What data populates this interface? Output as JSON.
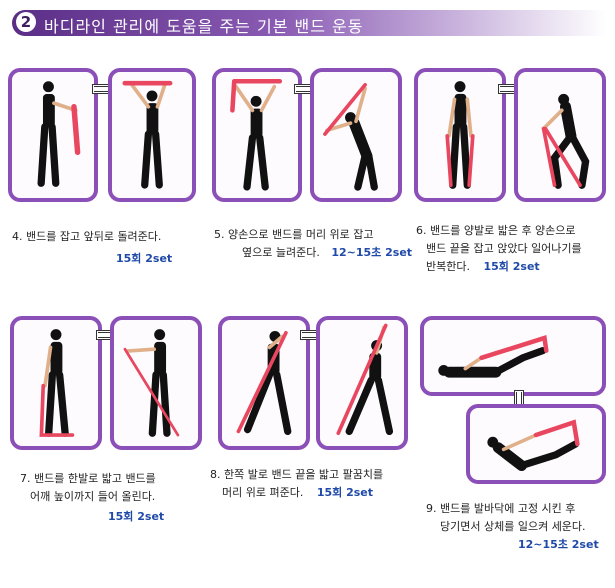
{
  "header": {
    "number": "2",
    "title": "바디라인 관리에 도움을 주는 기본 밴드 운동"
  },
  "exercises": [
    {
      "desc": [
        "4. 밴드를 잡고 앞뒤로 돌려준다."
      ],
      "reps": "15회  2set"
    },
    {
      "desc": [
        "5. 양손으로 밴드를 머리 위로 잡고",
        "옆으로 늘려준다."
      ],
      "reps": "12~15초  2set"
    },
    {
      "desc": [
        "6. 밴드를 양발로 밟은 후 양손으로",
        "밴드 끝을 잡고 앉았다 일어나기를",
        "반복한다."
      ],
      "reps": "15회  2set"
    },
    {
      "desc": [
        "7. 밴드를 한발로 밟고 밴드를",
        "어깨 높이까지 들어 올린다."
      ],
      "reps": "15회  2set"
    },
    {
      "desc": [
        "8. 한쪽 발로 밴드 끝을 밟고 팔꿈치를",
        "머리 위로 펴준다."
      ],
      "reps": "15회  2set"
    },
    {
      "desc": [
        "9. 밴드를 발바닥에 고정 시킨 후",
        "당기면서 상체를 일으켜 세운다."
      ],
      "reps": "12~15초  2set"
    }
  ],
  "colors": {
    "frame": "#8b4fb8",
    "band": "#e8475f",
    "reps": "#1f4aa8",
    "header": "#5a2d86"
  }
}
